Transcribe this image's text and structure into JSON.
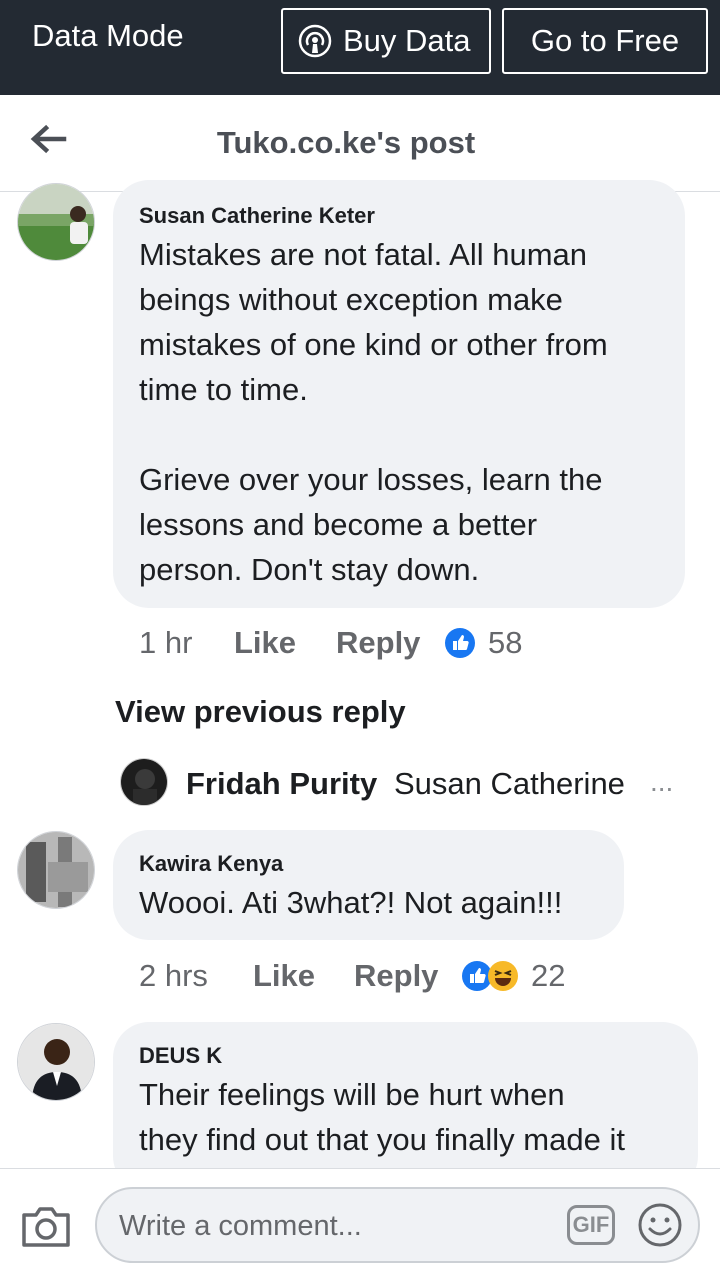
{
  "data_bar": {
    "mode_label": "Data Mode",
    "buy_label": "Buy Data",
    "free_label": "Go to Free"
  },
  "header": {
    "title": "Tuko.co.ke's post"
  },
  "comments": [
    {
      "author": "Susan Catherine Keter",
      "text_lines": [
        "Mistakes are not fatal. All human",
        "beings without exception make",
        "mistakes of one kind or other from",
        "time to time.",
        "",
        "Grieve over your losses, learn the",
        "lessons and become a better",
        "person. Don't stay down."
      ],
      "time": "1 hr",
      "like": "Like",
      "reply": "Reply",
      "reaction_count": "58",
      "reactions": [
        "like-icon"
      ]
    },
    {
      "author": "Kawira Kenya",
      "text_lines": [
        "Woooi. Ati 3what?! Not again!!!"
      ],
      "time": "2 hrs",
      "like": "Like",
      "reply": "Reply",
      "reaction_count": "22",
      "reactions": [
        "like-icon",
        "haha-icon"
      ]
    },
    {
      "author": "DEUS K",
      "text_lines": [
        "Their feelings will be hurt when",
        "they find out that you finally made it"
      ]
    }
  ],
  "view_previous": "View previous reply",
  "reply_preview": {
    "author": "Fridah Purity",
    "text": "Susan Catherine",
    "ellipsis": "..."
  },
  "composer": {
    "placeholder": "Write a comment...",
    "gif_label": "GIF"
  },
  "colors": {
    "data_bar_bg": "#232a33",
    "bubble_bg": "#f0f2f5",
    "like_blue": "#1877f2",
    "haha_yellow": "#f7b928"
  }
}
